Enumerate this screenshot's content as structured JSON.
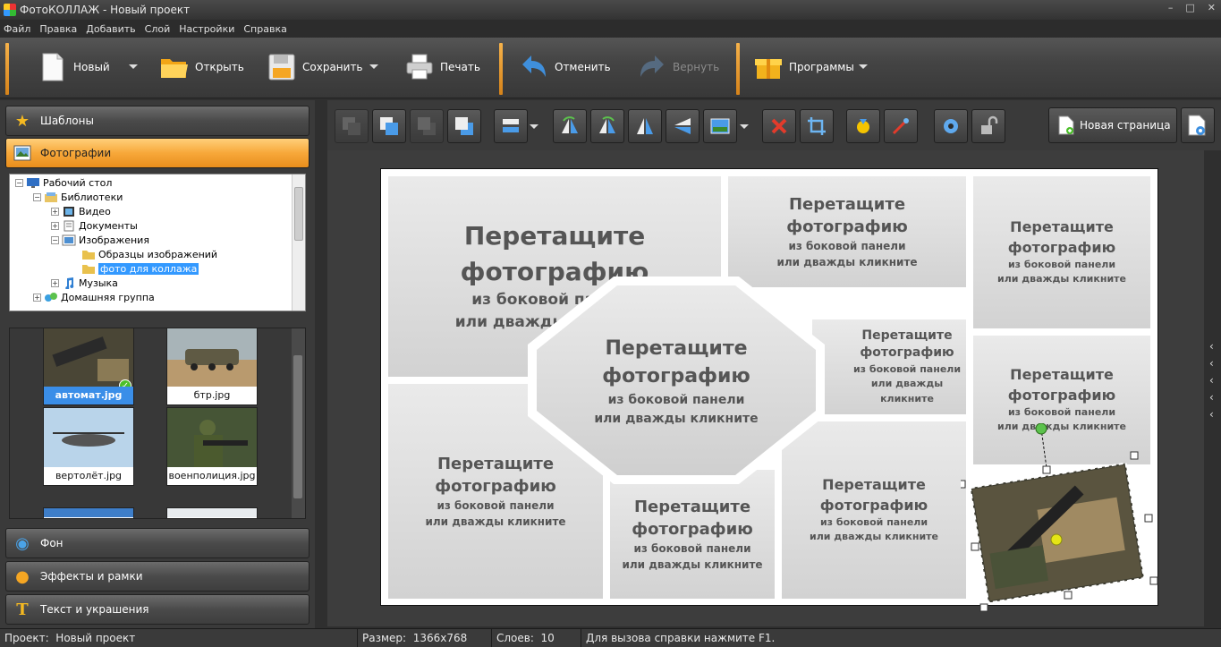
{
  "window": {
    "title": "ФотоКОЛЛАЖ - Новый проект"
  },
  "menu": [
    "Файл",
    "Правка",
    "Добавить",
    "Слой",
    "Настройки",
    "Справка"
  ],
  "main_toolbar": {
    "new": "Новый",
    "open": "Открыть",
    "save": "Сохранить",
    "print": "Печать",
    "undo": "Отменить",
    "redo": "Вернуть",
    "programs": "Программы"
  },
  "left_panel": {
    "templates": "Шаблоны",
    "photos": "Фотографии",
    "background": "Фон",
    "effects": "Эффекты и рамки",
    "text": "Текст и украшения"
  },
  "tree": [
    {
      "label": "Рабочий стол",
      "level": 0,
      "exp": "−",
      "icon": "desktop"
    },
    {
      "label": "Библиотеки",
      "level": 1,
      "exp": "−",
      "icon": "libraries"
    },
    {
      "label": "Видео",
      "level": 2,
      "exp": "+",
      "icon": "video"
    },
    {
      "label": "Документы",
      "level": 2,
      "exp": "+",
      "icon": "documents"
    },
    {
      "label": "Изображения",
      "level": 2,
      "exp": "−",
      "icon": "images"
    },
    {
      "label": "Образцы изображений",
      "level": 3,
      "exp": "",
      "icon": "folder"
    },
    {
      "label": "фото для коллажа",
      "level": 3,
      "exp": "",
      "icon": "folder",
      "selected": true
    },
    {
      "label": "Музыка",
      "level": 2,
      "exp": "+",
      "icon": "music"
    },
    {
      "label": "Домашняя группа",
      "level": 1,
      "exp": "+",
      "icon": "homegroup"
    }
  ],
  "thumbnails": [
    {
      "name": "автомат.jpg",
      "selected": true
    },
    {
      "name": "бтр.jpg"
    },
    {
      "name": "вертолёт.jpg"
    },
    {
      "name": "военполиция.jpg"
    }
  ],
  "editor_toolbar": {
    "new_page": "Новая страница"
  },
  "placeholder": {
    "line1": "Перетащите",
    "line2": "фотографию",
    "line3": "из боковой панели",
    "line4": "или дважды кликните"
  },
  "status": {
    "project_label": "Проект:",
    "project": "Новый проект",
    "size_label": "Размер:",
    "size": "1366x768",
    "layers_label": "Слоев:",
    "layers": "10",
    "help": "Для вызова справки нажмите F1."
  },
  "colors": {
    "accent": "#f7a83a",
    "selection": "#3399ff"
  }
}
